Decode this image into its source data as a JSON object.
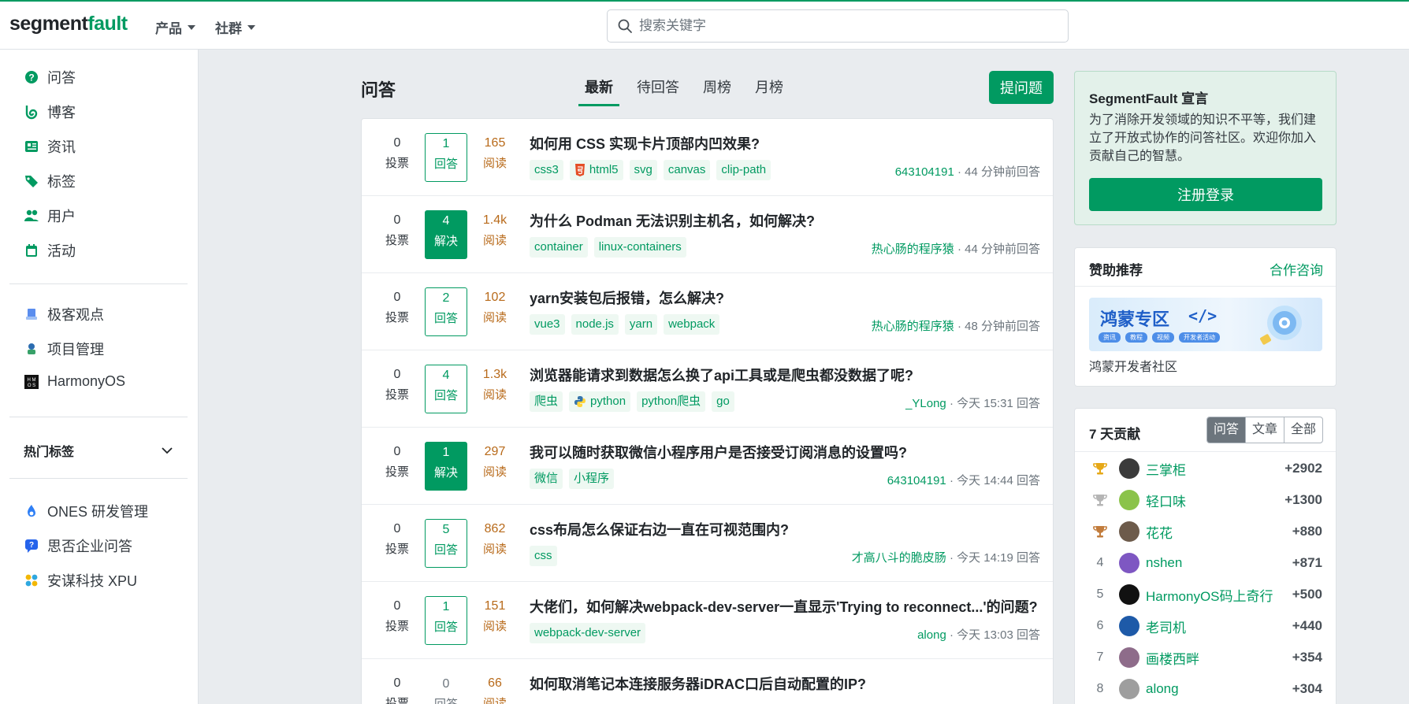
{
  "header": {
    "logo_main": "segment",
    "logo_accent": "fault",
    "nav": [
      "产品",
      "社群"
    ],
    "search_placeholder": "搜索关键字"
  },
  "sidebar": {
    "primary": [
      {
        "label": "问答",
        "icon": "question-circle-icon"
      },
      {
        "label": "博客",
        "icon": "blog-icon"
      },
      {
        "label": "资讯",
        "icon": "newspaper-icon"
      },
      {
        "label": "标签",
        "icon": "tags-icon"
      },
      {
        "label": "用户",
        "icon": "users-icon"
      },
      {
        "label": "活动",
        "icon": "calendar-icon"
      }
    ],
    "secondary": [
      {
        "label": "极客观点",
        "icon": "geek-icon"
      },
      {
        "label": "项目管理",
        "icon": "project-icon"
      },
      {
        "label": "HarmonyOS",
        "icon": "harmonyos-icon"
      }
    ],
    "hot_tags": "热门标签",
    "partners": [
      {
        "label": "ONES 研发管理",
        "icon": "ones-icon"
      },
      {
        "label": "思否企业问答",
        "icon": "enterprise-qa-icon"
      },
      {
        "label": "安谋科技 XPU",
        "icon": "xpu-icon"
      }
    ]
  },
  "main": {
    "title": "问答",
    "tabs": [
      "最新",
      "待回答",
      "周榜",
      "月榜"
    ],
    "active_tab": "最新",
    "ask_button": "提问题",
    "questions": [
      {
        "votes": "0",
        "votes_label": "投票",
        "answers": "1",
        "answers_label": "回答",
        "solved": false,
        "views": "165",
        "views_label": "阅读",
        "title": "如何用 CSS 实现卡片顶部内凹效果?",
        "tags": [
          "css3",
          "html5",
          "svg",
          "canvas",
          "clip-path"
        ],
        "author": "643104191",
        "time": "· 44 分钟前回答"
      },
      {
        "votes": "0",
        "votes_label": "投票",
        "answers": "4",
        "answers_label": "解决",
        "solved": true,
        "views": "1.4k",
        "views_label": "阅读",
        "title": "为什么 Podman 无法识别主机名，如何解决?",
        "tags": [
          "container",
          "linux-containers"
        ],
        "author": "热心肠的程序猿",
        "time": "· 44 分钟前回答"
      },
      {
        "votes": "0",
        "votes_label": "投票",
        "answers": "2",
        "answers_label": "回答",
        "solved": false,
        "views": "102",
        "views_label": "阅读",
        "title": "yarn安装包后报错，怎么解决?",
        "tags": [
          "vue3",
          "node.js",
          "yarn",
          "webpack"
        ],
        "author": "热心肠的程序猿",
        "time": "· 48 分钟前回答"
      },
      {
        "votes": "0",
        "votes_label": "投票",
        "answers": "4",
        "answers_label": "回答",
        "solved": false,
        "views": "1.3k",
        "views_label": "阅读",
        "title": "浏览器能请求到数据怎么换了api工具或是爬虫都没数据了呢?",
        "tags": [
          "爬虫",
          "python",
          "python爬虫",
          "go"
        ],
        "author": "_YLong",
        "time": "· 今天 15:31 回答"
      },
      {
        "votes": "0",
        "votes_label": "投票",
        "answers": "1",
        "answers_label": "解决",
        "solved": true,
        "views": "297",
        "views_label": "阅读",
        "title": "我可以随时获取微信小程序用户是否接受订阅消息的设置吗?",
        "tags": [
          "微信",
          "小程序"
        ],
        "author": "643104191",
        "time": "· 今天 14:44 回答"
      },
      {
        "votes": "0",
        "votes_label": "投票",
        "answers": "5",
        "answers_label": "回答",
        "solved": false,
        "views": "862",
        "views_label": "阅读",
        "title": "css布局怎么保证右边一直在可视范围内?",
        "tags": [
          "css"
        ],
        "author": "才高八斗的脆皮肠",
        "time": "· 今天 14:19 回答"
      },
      {
        "votes": "0",
        "votes_label": "投票",
        "answers": "1",
        "answers_label": "回答",
        "solved": false,
        "views": "151",
        "views_label": "阅读",
        "title": "大佬们，如何解决webpack-dev-server一直显示'Trying to reconnect...'的问题?",
        "tags": [
          "webpack-dev-server"
        ],
        "author": "along",
        "time": "· 今天 13:03 回答"
      },
      {
        "votes": "0",
        "votes_label": "投票",
        "answers": "0",
        "answers_label": "回答",
        "solved": false,
        "views": "66",
        "views_label": "阅读",
        "title": "如何取消笔记本连接服务器iDRAC口后自动配置的IP?",
        "tags": [],
        "author": "",
        "time": ""
      }
    ]
  },
  "right": {
    "declare_title": "SegmentFault 宣言",
    "declare_text": "为了消除开发领域的知识不平等，我们建立了开放式协作的问答社区。欢迎你加入贡献自己的智慧。",
    "register_button": "注册登录",
    "sponsor_title": "赞助推荐",
    "sponsor_link": "合作咨询",
    "banner_title": "鸿蒙专区",
    "banner_code": "</>",
    "banner_chips": [
      "资讯",
      "教程",
      "视频",
      "开发者活动"
    ],
    "banner_caption": "鸿蒙开发者社区",
    "contrib_title": "7 天贡献",
    "contrib_tabs": [
      "问答",
      "文章",
      "全部"
    ],
    "contributors": [
      {
        "rank": "1",
        "name": "三掌柜",
        "score": "+2902",
        "trophy": "gold"
      },
      {
        "rank": "2",
        "name": "轻口味",
        "score": "+1300",
        "trophy": "silver"
      },
      {
        "rank": "3",
        "name": "花花",
        "score": "+880",
        "trophy": "bronze"
      },
      {
        "rank": "4",
        "name": "nshen",
        "score": "+871"
      },
      {
        "rank": "5",
        "name": "HarmonyOS码上奇行",
        "score": "+500"
      },
      {
        "rank": "6",
        "name": "老司机",
        "score": "+440"
      },
      {
        "rank": "7",
        "name": "画楼西畔",
        "score": "+354"
      },
      {
        "rank": "8",
        "name": "along",
        "score": "+304"
      }
    ],
    "colors": {
      "brand": "#019a61",
      "gold": "#e6a817",
      "silver": "#b5b5b5",
      "bronze": "#c27c3c"
    }
  }
}
